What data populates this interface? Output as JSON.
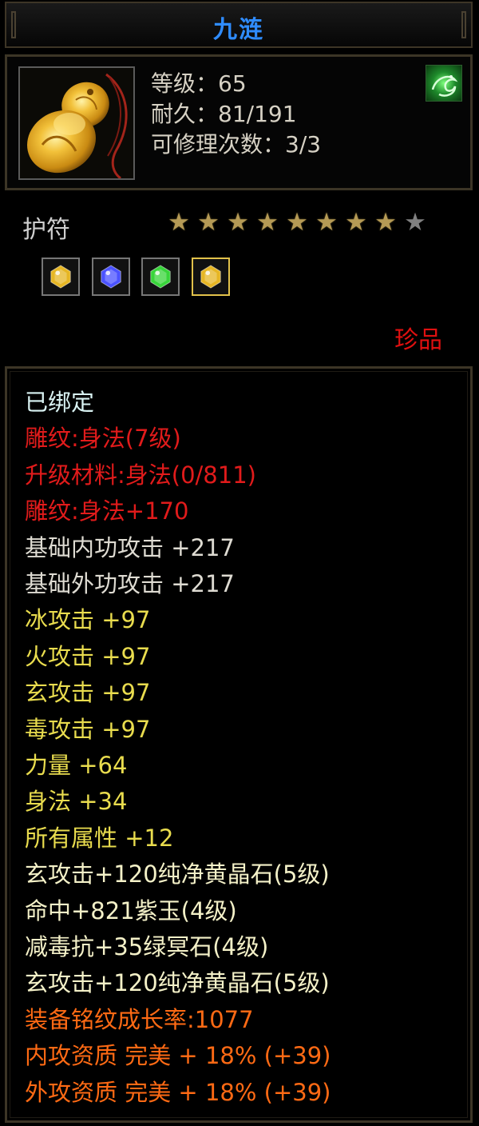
{
  "item": {
    "name": "九涟",
    "stats": {
      "level_text": "等级：65",
      "durability_text": "耐久：81/191",
      "repair_text": "可修理次数：3/3"
    },
    "type": "护符",
    "stars": {
      "total": 9,
      "filled": 8
    },
    "gems": [
      {
        "icon": "yellow-crystal-gem-icon",
        "color": "#e6b624"
      },
      {
        "icon": "purple-jade-gem-icon",
        "color": "#4a52ff"
      },
      {
        "icon": "green-gem-icon",
        "color": "#38d53a"
      },
      {
        "icon": "yellow-crystal-gem-icon",
        "color": "#e6b624"
      }
    ],
    "rarity": "珍品",
    "attributes": [
      {
        "text": "已绑定"
      },
      {
        "text": "雕纹:身法(7级)"
      },
      {
        "text": "升级材料:身法(0/811)"
      },
      {
        "text": "雕纹:身法+170"
      },
      {
        "text": "基础内功攻击 +217"
      },
      {
        "text": "基础外功攻击 +217"
      },
      {
        "text": "冰攻击 +97"
      },
      {
        "text": "火攻击 +97"
      },
      {
        "text": "玄攻击 +97"
      },
      {
        "text": "毒攻击 +97"
      },
      {
        "text": "力量 +64"
      },
      {
        "text": "身法 +34"
      },
      {
        "text": "所有属性 +12"
      },
      {
        "text": "玄攻击+120纯净黄晶石(5级)"
      },
      {
        "text": "命中+821紫玉(4级)"
      },
      {
        "text": "减毒抗+35绿冥石(4级)"
      },
      {
        "text": "玄攻击+120纯净黄晶石(5级)"
      },
      {
        "text": "装备铭纹成长率:1077"
      },
      {
        "text": "内攻资质 完美 + 18% (+39)"
      },
      {
        "text": "外攻资质 完美 + 18% (+39)"
      }
    ]
  },
  "colors": {
    "title": "#2f8cff",
    "rarity": "#e01010",
    "bound": "#d9f2f2",
    "engraving": "#e11b1b",
    "base_attack": "#dedbd2",
    "elemental": "#e9dc4e",
    "socket": "#f4f1c8",
    "growth": "#ff6a14"
  }
}
